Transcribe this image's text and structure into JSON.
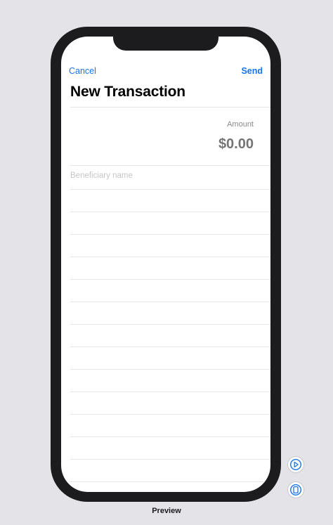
{
  "nav": {
    "cancel_label": "Cancel",
    "send_label": "Send"
  },
  "page": {
    "title": "New Transaction"
  },
  "form": {
    "amount_label": "Amount",
    "amount_placeholder": "$0.00",
    "beneficiary_placeholder": "Beneficiary name",
    "beneficiary_value": ""
  },
  "preview": {
    "label": "Preview",
    "live_button_icon": "play-circle-icon",
    "device_button_icon": "device-settings-icon"
  },
  "colors": {
    "accent": "#1a73e8",
    "frame": "#1c1c1e",
    "canvas": "#e4e3e8"
  }
}
